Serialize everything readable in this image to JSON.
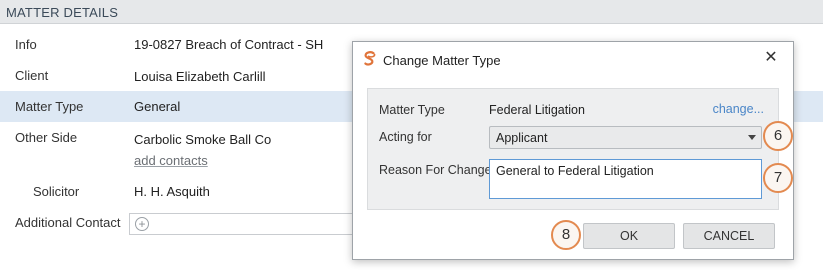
{
  "section": {
    "title": "MATTER DETAILS"
  },
  "details": {
    "info": {
      "label": "Info",
      "value": "19-0827 Breach of Contract - SH"
    },
    "client": {
      "label": "Client",
      "value": "Louisa Elizabeth Carlill"
    },
    "matter_type": {
      "label": "Matter Type",
      "value": "General"
    },
    "other_side": {
      "label": "Other Side",
      "value": "Carbolic Smoke Ball Co",
      "add_link": "add contacts"
    },
    "solicitor": {
      "label": "Solicitor",
      "value": "H. H. Asquith"
    },
    "additional_contact": {
      "label": "Additional Contact",
      "add_icon": "plus-icon"
    }
  },
  "modal": {
    "title": "Change Matter Type",
    "logo_icon": "smokeball-logo",
    "close_icon": "close-icon",
    "matter_type": {
      "label": "Matter Type",
      "value": "Federal Litigation",
      "change_link": "change..."
    },
    "acting_for": {
      "label": "Acting for",
      "selected": "Applicant"
    },
    "reason": {
      "label": "Reason For Change",
      "value": "General to Federal Litigation"
    },
    "ok_label": "OK",
    "cancel_label": "CANCEL"
  },
  "steps": {
    "six": "6",
    "seven": "7",
    "eight": "8"
  },
  "colors": {
    "highlight_row": "#dde8f4",
    "link": "#4a86c8",
    "step_ring": "#e38a50",
    "logo": "#e0743a"
  }
}
